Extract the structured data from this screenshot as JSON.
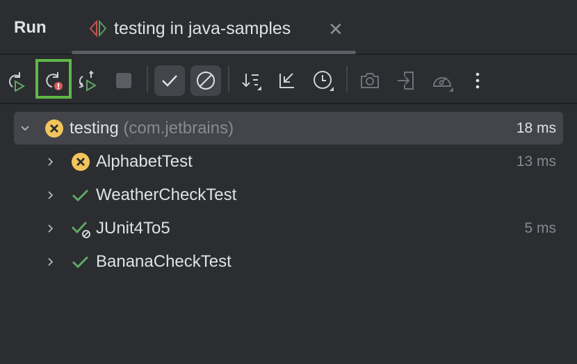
{
  "header": {
    "title": "Run",
    "tab": {
      "label": "testing in java-samples",
      "icon": "run-config-icon",
      "close_icon": "close-icon"
    }
  },
  "toolbar": {
    "items": [
      {
        "name": "rerun",
        "icon": "rerun-icon"
      },
      {
        "name": "rerun-failed",
        "icon": "rerun-failed-icon",
        "highlighted": true
      },
      {
        "name": "toggle-auto-test",
        "icon": "auto-rerun-icon"
      },
      {
        "name": "stop",
        "icon": "stop-icon"
      },
      {
        "name": "show-passed",
        "icon": "check-icon",
        "toggled": true
      },
      {
        "name": "show-ignored",
        "icon": "ignored-icon",
        "toggled": true
      },
      {
        "name": "sort",
        "icon": "sort-icon"
      },
      {
        "name": "collapse",
        "icon": "collapse-icon"
      },
      {
        "name": "history",
        "icon": "clock-icon"
      },
      {
        "name": "screenshot",
        "icon": "camera-icon"
      },
      {
        "name": "import",
        "icon": "import-icon"
      },
      {
        "name": "coverage",
        "icon": "gauge-icon"
      },
      {
        "name": "more",
        "icon": "more-icon"
      }
    ]
  },
  "tree": {
    "root": {
      "name": "testing",
      "package": "(com.jetbrains)",
      "time": "18 ms",
      "status": "failed",
      "expanded": true
    },
    "children": [
      {
        "name": "AlphabetTest",
        "time": "13 ms",
        "status": "failed"
      },
      {
        "name": "WeatherCheckTest",
        "time": "",
        "status": "passed"
      },
      {
        "name": "JUnit4To5",
        "time": "5 ms",
        "status": "passed-ignored"
      },
      {
        "name": "BananaCheckTest",
        "time": "",
        "status": "passed"
      }
    ]
  },
  "colors": {
    "bg": "#2b2d30",
    "accent_green": "#5fb847",
    "fail": "#f2c55c",
    "pass": "#5fa865",
    "error": "#db5c5c"
  }
}
